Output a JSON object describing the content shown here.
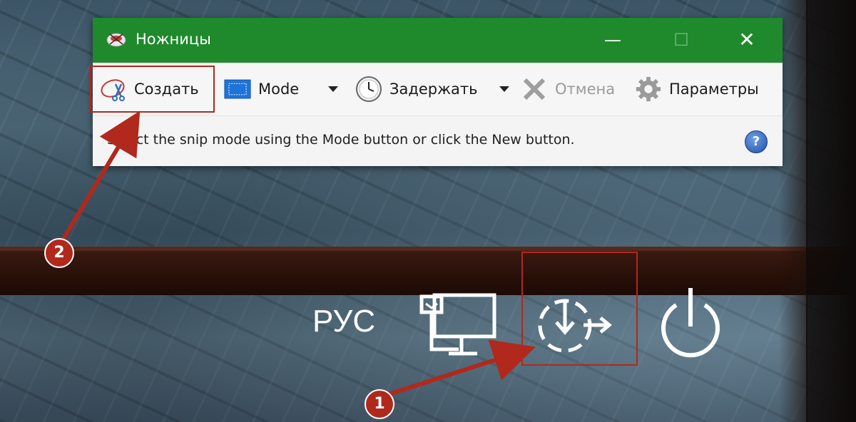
{
  "window": {
    "title": "Ножницы",
    "minimize": "—",
    "maximize": "☐",
    "close": "✕"
  },
  "toolbar": {
    "new_label": "Создать",
    "mode_label": "Mode",
    "delay_label": "Задержать",
    "cancel_label": "Отмена",
    "options_label": "Параметры"
  },
  "status": {
    "text": "Select the snip mode using the Mode button or click the New button.",
    "help": "?"
  },
  "lock_screen": {
    "language": "РУС",
    "icons": [
      "network-icon",
      "update-and-restart-icon",
      "power-icon"
    ]
  },
  "annotations": {
    "badge_1": "1",
    "badge_2": "2",
    "color": "#b0291c"
  }
}
